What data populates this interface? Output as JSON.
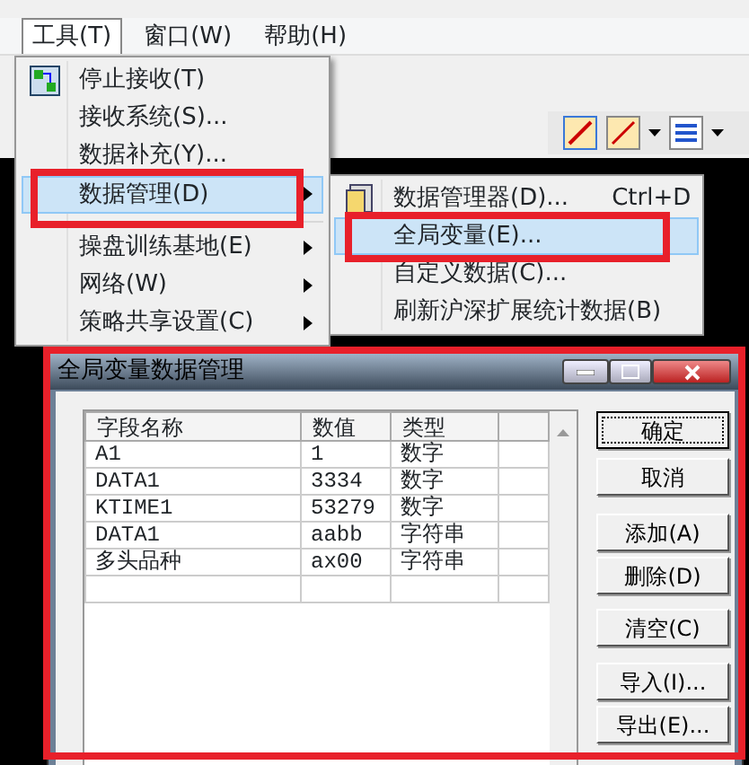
{
  "menu_bar": [
    {
      "label": "工具(T)",
      "selected": true
    },
    {
      "label": "窗口(W)",
      "selected": false
    },
    {
      "label": "帮助(H)",
      "selected": false
    }
  ],
  "tools_menu": [
    {
      "label": "停止接收(T)",
      "icon": true,
      "submenu": false,
      "selected": false,
      "separator_after": false
    },
    {
      "label": "接收系统(S)...",
      "icon": false,
      "submenu": false,
      "selected": false,
      "separator_after": false
    },
    {
      "label": "数据补充(Y)...",
      "icon": false,
      "submenu": false,
      "selected": false,
      "separator_after": false
    },
    {
      "label": "数据管理(D)",
      "icon": false,
      "submenu": true,
      "selected": true,
      "separator_after": true
    },
    {
      "label": "操盘训练基地(E)",
      "icon": false,
      "submenu": true,
      "selected": false,
      "separator_after": false
    },
    {
      "label": "网络(W)",
      "icon": false,
      "submenu": true,
      "selected": false,
      "separator_after": false
    },
    {
      "label": "策略共享设置(C)",
      "icon": false,
      "submenu": true,
      "selected": false,
      "separator_after": false
    }
  ],
  "data_submenu": [
    {
      "label": "数据管理器(D)...",
      "shortcut": "Ctrl+D",
      "icon": true,
      "selected": false
    },
    {
      "label": "全局变量(E)...",
      "icon": false,
      "selected": true
    },
    {
      "label": "自定义数据(C)...",
      "icon": false,
      "selected": false
    },
    {
      "label": "刷新沪深扩展统计数据(B)",
      "icon": false,
      "selected": false
    }
  ],
  "dialog": {
    "title": "全局变量数据管理",
    "columns": [
      "字段名称",
      "数值",
      "类型"
    ],
    "rows": [
      [
        "A1",
        "1",
        "数字"
      ],
      [
        "DATA1",
        "3334",
        "数字"
      ],
      [
        "KTIME1",
        "53279",
        "数字"
      ],
      [
        "DATA1",
        "aabb",
        "字符串"
      ],
      [
        "多头品种",
        "ax00",
        "字符串"
      ]
    ],
    "buttons": [
      {
        "label": "确定",
        "focused": true
      },
      {
        "label": "取消",
        "focused": false
      },
      {
        "label": "添加(A)",
        "focused": false
      },
      {
        "label": "删除(D)",
        "focused": false
      },
      {
        "label": "清空(C)",
        "focused": false
      },
      {
        "label": "导入(I)...",
        "focused": false
      },
      {
        "label": "导出(E)...",
        "focused": false
      }
    ]
  }
}
